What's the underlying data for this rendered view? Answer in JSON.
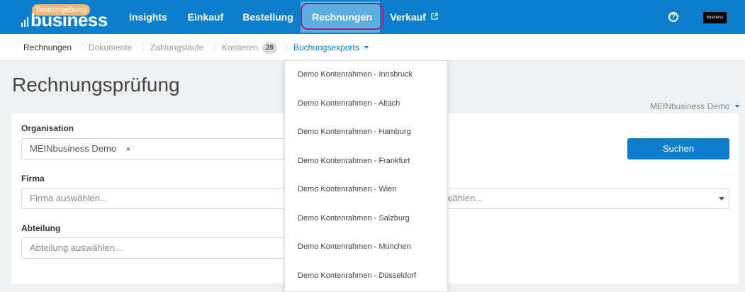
{
  "brand": {
    "env_label": "Testumgebung",
    "word": "business"
  },
  "nav": {
    "items": [
      {
        "label": "Insights"
      },
      {
        "label": "Einkauf"
      },
      {
        "label": "Bestellung"
      },
      {
        "label": "Rechnungen",
        "active": true
      },
      {
        "label": "Verkauf",
        "external": true
      }
    ],
    "user_logo_text": "business"
  },
  "subnav": {
    "items": [
      {
        "label": "Rechnungen"
      },
      {
        "label": "Dokumente"
      },
      {
        "label": "Zahlungsläufe"
      },
      {
        "label": "Kontieren",
        "badge": "28"
      },
      {
        "label": "Buchungsexports"
      }
    ]
  },
  "page": {
    "title": "Rechnungsprüfung",
    "org_switch": "MEINbusiness Demo"
  },
  "filters": {
    "organisation": {
      "label": "Organisation",
      "value": "MEINbusiness Demo"
    },
    "firma": {
      "label": "Firma",
      "placeholder": "Firma auswählen..."
    },
    "second_select_partial": "wählen...",
    "abteilung": {
      "label": "Abteilung",
      "placeholder": "Abteilung auswählen..."
    },
    "search_button": "Suchen"
  },
  "dropdown": {
    "items": [
      "Demo Kontenrahmen - Innsbruck",
      "Demo Kontenrahmen - Altach",
      "Demo Kontenrahmen - Hamburg",
      "Demo Kontenrahmen - Frankfurt",
      "Demo Kontenrahmen - Wien",
      "Demo Kontenrahmen - Salzburg",
      "Demo Kontenrahmen - München",
      "Demo Kontenrahmen - Düsseldorf"
    ]
  },
  "colors": {
    "primary": "#0b7fcb",
    "active_tab": "#5aaee0",
    "highlight": "#b0198c",
    "env_badge": "#f0b87a"
  }
}
